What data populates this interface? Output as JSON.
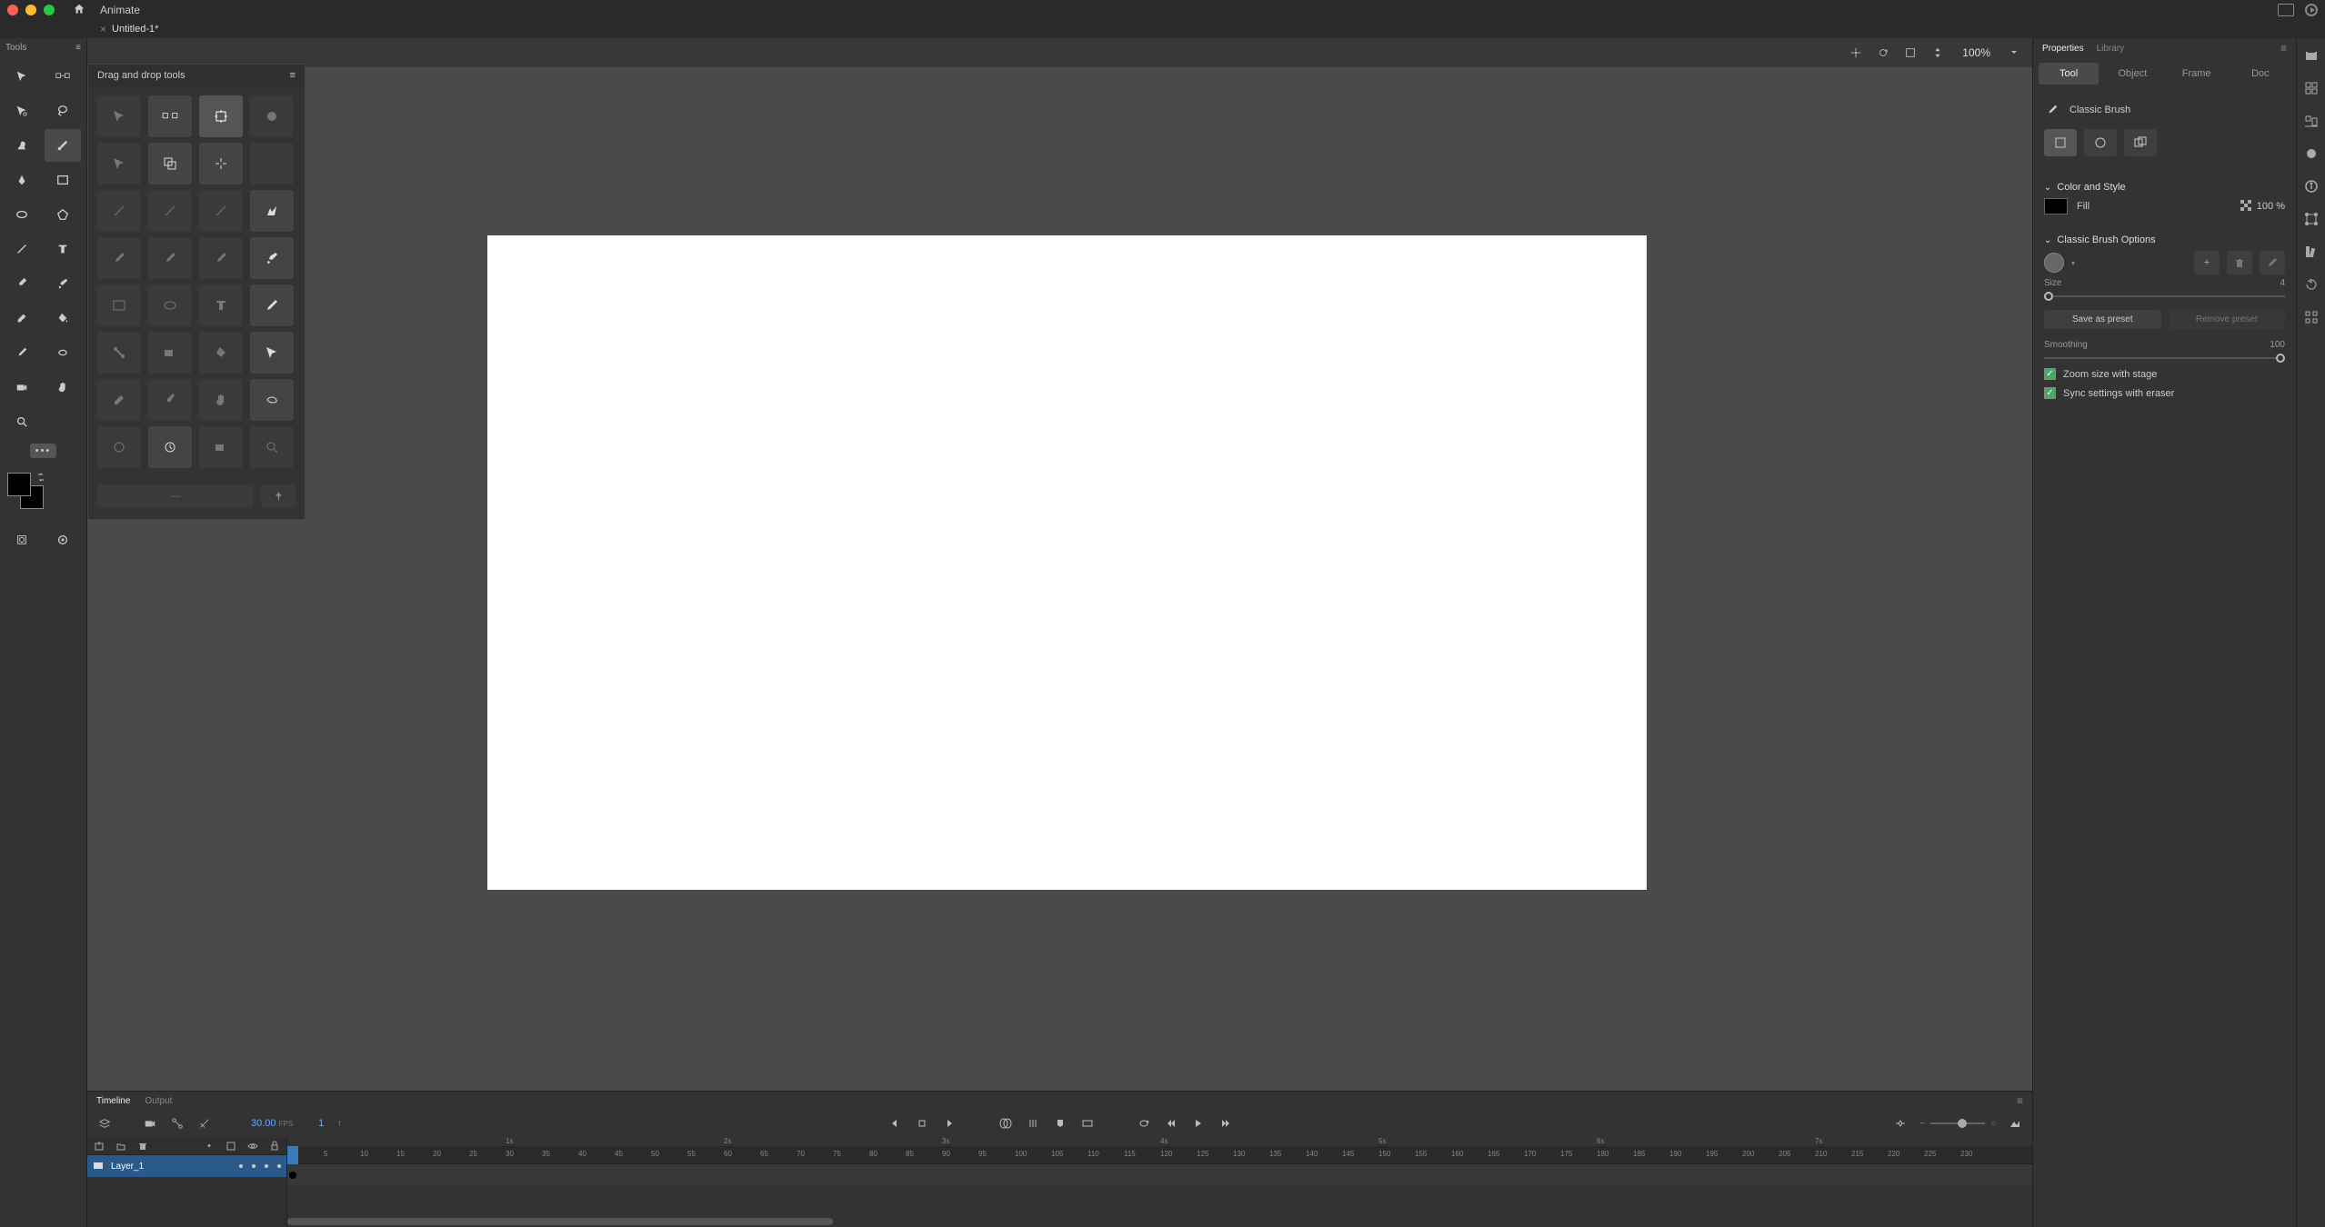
{
  "app": {
    "name": "Animate"
  },
  "document": {
    "tab_name": "Untitled-1*"
  },
  "tools_panel": {
    "title": "Tools"
  },
  "dnd_panel": {
    "title": "Drag and drop tools"
  },
  "stage": {
    "zoom": "100%"
  },
  "properties": {
    "tabs": {
      "properties": "Properties",
      "library": "Library"
    },
    "sub_tabs": {
      "tool": "Tool",
      "object": "Object",
      "frame": "Frame",
      "doc": "Doc"
    },
    "tool_name": "Classic Brush",
    "sections": {
      "color_style": "Color and Style",
      "brush_options": "Classic Brush Options"
    },
    "fill": {
      "label": "Fill",
      "opacity": "100 %"
    },
    "size": {
      "label": "Size",
      "value": "4"
    },
    "presets": {
      "save": "Save as preset",
      "remove": "Remove preset"
    },
    "smoothing": {
      "label": "Smoothing",
      "value": "100"
    },
    "zoom_with_stage": "Zoom size with stage",
    "sync_eraser": "Sync settings with eraser"
  },
  "timeline": {
    "tabs": {
      "timeline": "Timeline",
      "output": "Output"
    },
    "fps": "30.00",
    "fps_label": "FPS",
    "current_frame": "1",
    "frame_label": "f",
    "layer_name": "Layer_1",
    "second_marks": [
      "1s",
      "2s",
      "3s",
      "4s",
      "5s",
      "6s",
      "7s"
    ],
    "ruler_ticks": [
      5,
      10,
      15,
      20,
      25,
      30,
      35,
      40,
      45,
      50,
      55,
      60,
      65,
      70,
      75,
      80,
      85,
      90,
      95,
      100,
      105,
      110,
      115,
      120,
      125,
      130,
      135,
      140,
      145,
      150,
      155,
      160,
      165,
      170,
      175,
      180,
      185,
      190,
      195,
      200,
      205,
      210,
      215,
      220,
      225,
      230
    ]
  }
}
